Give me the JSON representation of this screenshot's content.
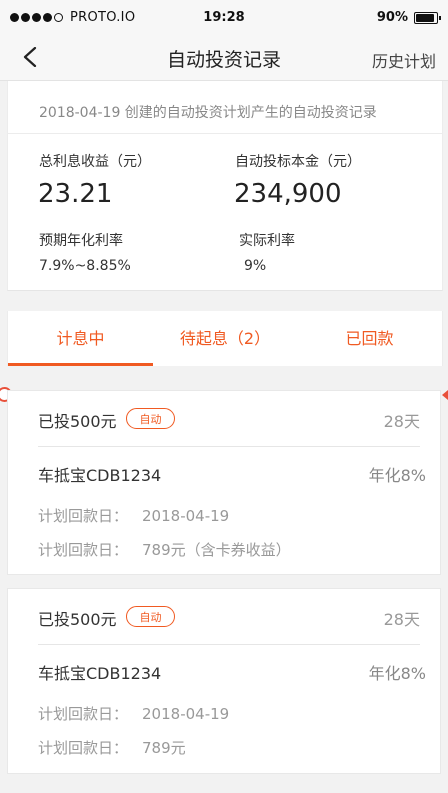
{
  "status_bar": {
    "carrier": "PROTO.IO",
    "time": "19:28",
    "battery": "90%"
  },
  "nav": {
    "title": "自动投资记录",
    "action": "历史计划"
  },
  "summary": {
    "note": "2018-04-19 创建的自动投资计划产生的自动投资记录",
    "total_interest_label": "总利息收益（元）",
    "total_interest_value": "23.21",
    "principal_label": "自动投标本金（元）",
    "principal_value": "234,900",
    "expected_rate_label": "预期年化利率",
    "expected_rate_value": "7.9%~8.85%",
    "actual_rate_label": "实际利率",
    "actual_rate_value": "9%"
  },
  "tabs": [
    {
      "label": "计息中",
      "active": true
    },
    {
      "label": "待起息（2）",
      "active": false
    },
    {
      "label": "已回款",
      "active": false
    }
  ],
  "records": [
    {
      "amount": "已投500元",
      "tag": "自动",
      "days": "28天",
      "product": "车抵宝CDB1234",
      "rate": "年化8%",
      "date_label": "计划回款日：",
      "date_value": "2018-04-19",
      "payback_label": "计划回款日：",
      "payback_value": "789元（含卡券收益）"
    },
    {
      "amount": "已投500元",
      "tag": "自动",
      "days": "28天",
      "product": "车抵宝CDB1234",
      "rate": "年化8%",
      "date_label": "计划回款日：",
      "date_value": "2018-04-19",
      "payback_label": "计划回款日：",
      "payback_value": "789元"
    }
  ],
  "colors": {
    "accent": "#f05a22",
    "background": "#f2f2f2",
    "text_muted": "#999999"
  },
  "icons": [
    "signal-dots-icon",
    "battery-icon",
    "back-chevron-icon"
  ]
}
